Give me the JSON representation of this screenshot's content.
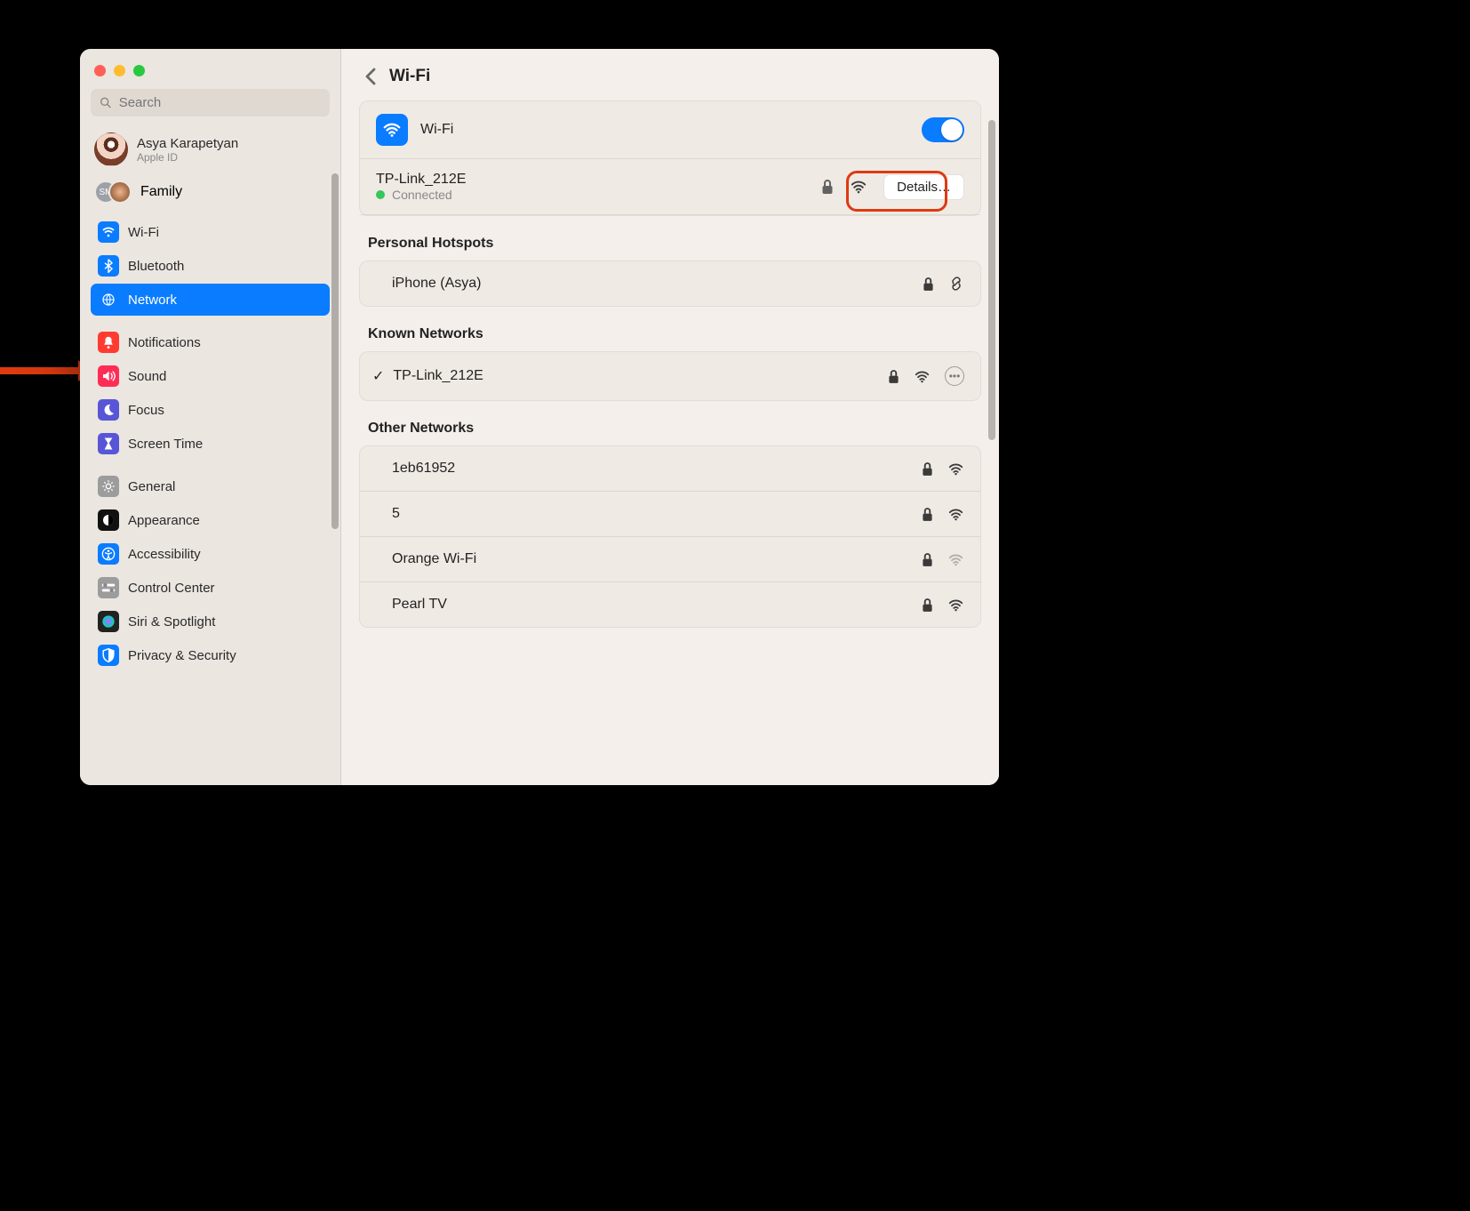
{
  "sidebar": {
    "search_placeholder": "Search",
    "account": {
      "name": "Asya Karapetyan",
      "sub": "Apple ID"
    },
    "family_label": "Family",
    "family_initials": "SM",
    "items": [
      {
        "label": "Wi-Fi",
        "key": "wifi",
        "color": "#0a7cff"
      },
      {
        "label": "Bluetooth",
        "key": "bluetooth",
        "color": "#0a7cff"
      },
      {
        "label": "Network",
        "key": "network",
        "color": "#0a7cff",
        "selected": true
      },
      {
        "label": "Notifications",
        "key": "notifications",
        "color": "#ff3b30"
      },
      {
        "label": "Sound",
        "key": "sound",
        "color": "#ff2d55"
      },
      {
        "label": "Focus",
        "key": "focus",
        "color": "#5856d6"
      },
      {
        "label": "Screen Time",
        "key": "screentime",
        "color": "#5856d6"
      },
      {
        "label": "General",
        "key": "general",
        "color": "#9c9c9c"
      },
      {
        "label": "Appearance",
        "key": "appearance",
        "color": "#111"
      },
      {
        "label": "Accessibility",
        "key": "accessibility",
        "color": "#0a7cff"
      },
      {
        "label": "Control Center",
        "key": "controlcenter",
        "color": "#9c9c9c"
      },
      {
        "label": "Siri & Spotlight",
        "key": "siri",
        "color": "#222"
      },
      {
        "label": "Privacy & Security",
        "key": "privacy",
        "color": "#0a7cff"
      }
    ]
  },
  "main": {
    "title": "Wi-Fi",
    "wifi_row_label": "Wi-Fi",
    "current": {
      "name": "TP-Link_212E",
      "status": "Connected",
      "details_btn": "Details…"
    },
    "sections": {
      "hotspots_title": "Personal Hotspots",
      "known_title": "Known Networks",
      "other_title": "Other Networks"
    },
    "hotspots": [
      {
        "name": "iPhone (Asya)",
        "lock": true,
        "link": true
      }
    ],
    "known": [
      {
        "name": "TP-Link_212E",
        "checked": true,
        "lock": true,
        "wifi": true,
        "more": true
      }
    ],
    "other": [
      {
        "name": "1eb61952",
        "lock": true,
        "wifi": true
      },
      {
        "name": "5",
        "lock": true,
        "wifi": true
      },
      {
        "name": "Orange Wi-Fi",
        "lock": true,
        "wifi_weak": true
      },
      {
        "name": "Pearl TV",
        "lock": true,
        "wifi": true
      }
    ]
  }
}
